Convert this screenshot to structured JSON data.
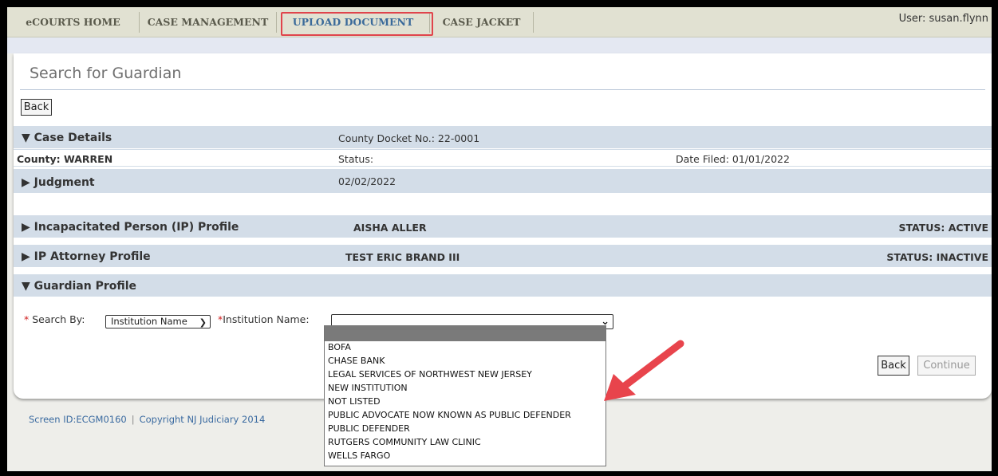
{
  "nav": {
    "tabs": [
      {
        "label": "eCOURTS HOME"
      },
      {
        "label": "CASE MANAGEMENT"
      },
      {
        "label": "UPLOAD DOCUMENT"
      },
      {
        "label": "CASE JACKET"
      }
    ],
    "active_tab": "UPLOAD DOCUMENT",
    "user": "User: susan.flynn"
  },
  "page": {
    "title": "Search for Guardian",
    "back_label": "Back"
  },
  "case_details": {
    "label": "Case Details",
    "docket": "County Docket No.: 22-0001",
    "county": "County: WARREN",
    "status": "Status:",
    "date_filed": "Date Filed: 01/01/2022"
  },
  "judgment": {
    "label": "Judgment",
    "value": "02/02/2022"
  },
  "ip_profile": {
    "label": "Incapacitated Person (IP) Profile",
    "name": "AISHA ALLER",
    "status": "STATUS: ACTIVE"
  },
  "ip_attorney": {
    "label": "IP Attorney Profile",
    "name": "TEST ERIC BRAND III",
    "status": "STATUS: INACTIVE"
  },
  "guardian_profile": {
    "label": "Guardian Profile",
    "search_by_label": "Search By:",
    "search_by_value": "Institution Name",
    "institution_label": "Institution Name:",
    "institution_value": "",
    "options": [
      "BOFA",
      "CHASE BANK",
      "LEGAL SERVICES OF NORTHWEST NEW JERSEY",
      "NEW INSTITUTION",
      "NOT LISTED",
      "PUBLIC ADVOCATE NOW KNOWN AS PUBLIC DEFENDER",
      "PUBLIC DEFENDER",
      "RUTGERS COMMUNITY LAW CLINIC",
      "WELLS FARGO"
    ],
    "back_label": "Back",
    "continue_label": "Continue"
  },
  "footer": {
    "screen_id": "Screen ID:ECGM0160",
    "separator": "|",
    "copyright": "Copyright NJ Judiciary 2014"
  },
  "colors": {
    "highlight": "#e0444c",
    "header_row": "#d3dde8",
    "arrow": "#e8444c"
  },
  "icons": {
    "expanded": "triangle-down-icon",
    "collapsed": "triangle-right-icon",
    "dropdown": "chevron-down-icon"
  }
}
